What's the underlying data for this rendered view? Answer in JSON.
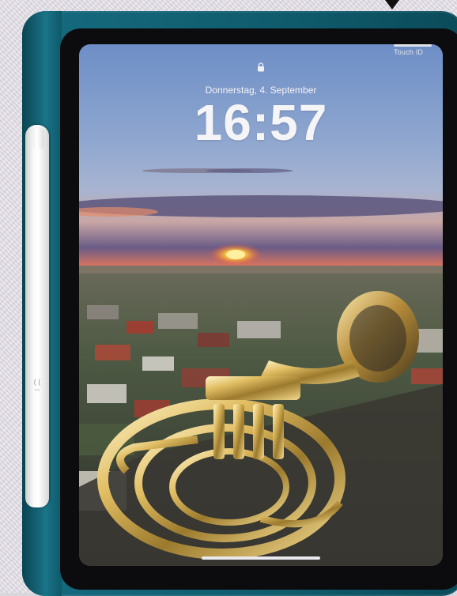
{
  "lockscreen": {
    "touch_id_label": "Touch ID",
    "date": "Donnerstag, 4. September",
    "time": "16:57"
  },
  "icons": {
    "lock": "lock-icon",
    "top_marker": "triangle-down-icon"
  },
  "colors": {
    "case": "#0f5b6c",
    "bezel": "#0c0c0e",
    "sky_top": "#6f8fc4",
    "sunset": "#f3553a",
    "sun": "#ffcf3a",
    "horn_gold": "#c9a34a"
  }
}
